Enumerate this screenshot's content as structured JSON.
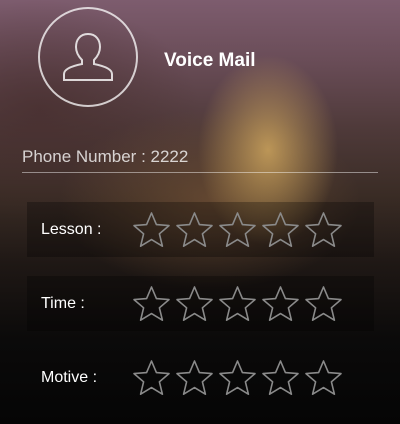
{
  "header": {
    "title": "Voice Mail",
    "avatar_icon": "user-silhouette-icon"
  },
  "phone": {
    "text": "Phone Number : 2222"
  },
  "ratings": [
    {
      "label": "Lesson :",
      "stars_total": 5,
      "stars_filled": 0
    },
    {
      "label": "Time :",
      "stars_total": 5,
      "stars_filled": 0
    },
    {
      "label": "Motive :",
      "stars_total": 5,
      "stars_filled": 0
    }
  ],
  "colors": {
    "star_outline": "#8a8a8a",
    "text": "#ffffff"
  }
}
